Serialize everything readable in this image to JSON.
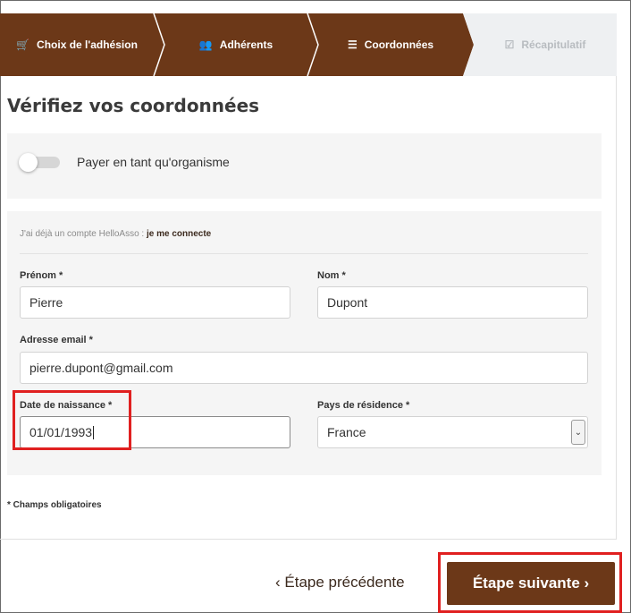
{
  "steps": [
    {
      "label": "Choix de l'adhésion",
      "icon": "cart-icon",
      "glyph": "🛒"
    },
    {
      "label": "Adhérents",
      "icon": "users-icon",
      "glyph": "👥"
    },
    {
      "label": "Coordonnées",
      "icon": "list-icon",
      "glyph": "☰"
    },
    {
      "label": "Récapitulatif",
      "icon": "checkbox-icon",
      "glyph": "☑"
    }
  ],
  "colors": {
    "step_active": "#6c3818",
    "step_inactive": "#eef0f2",
    "highlight": "#e02020"
  },
  "page": {
    "title": "Vérifiez vos coordonnées"
  },
  "organism": {
    "label": "Payer en tant qu'organisme",
    "checked": false
  },
  "login": {
    "text": "J'ai déjà un compte HelloAsso : ",
    "link": "je me connecte"
  },
  "form": {
    "prenom": {
      "label": "Prénom *",
      "value": "Pierre"
    },
    "nom": {
      "label": "Nom *",
      "value": "Dupont"
    },
    "email": {
      "label": "Adresse email *",
      "value": "pierre.dupont@gmail.com"
    },
    "birthdate": {
      "label": "Date de naissance *",
      "value": "01/01/1993"
    },
    "country": {
      "label": "Pays de résidence *",
      "value": "France"
    }
  },
  "required_note": "* Champs obligatoires",
  "nav": {
    "prev": "‹  Étape précédente",
    "next": "Étape suivante  ›"
  }
}
